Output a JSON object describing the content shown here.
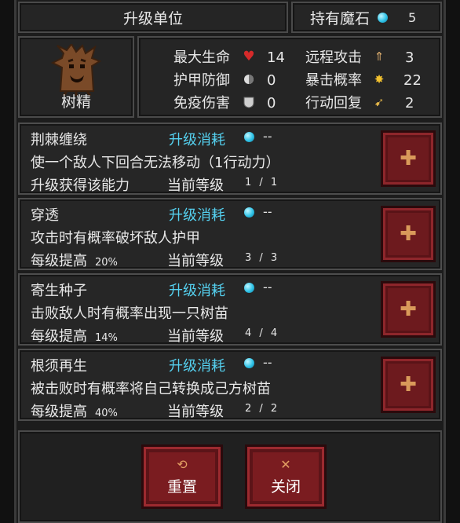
{
  "header": {
    "title": "升级单位",
    "stones_label": "持有魔石",
    "stones_count": "5"
  },
  "unit": {
    "name": "树精"
  },
  "stats": [
    {
      "label": "最大生命",
      "icon": "heart-icon",
      "value": "14"
    },
    {
      "label": "护甲防御",
      "icon": "armor-icon",
      "value": "0"
    },
    {
      "label": "免疫伤害",
      "icon": "shield-icon",
      "value": "0"
    },
    {
      "label": "远程攻击",
      "icon": "arrow-up-icon",
      "value": "3"
    },
    {
      "label": "暴击概率",
      "icon": "burst-icon",
      "value": "22"
    },
    {
      "label": "行动回复",
      "icon": "boot-icon",
      "value": "2"
    }
  ],
  "skills": [
    {
      "name": "荆棘缠绕",
      "cost_label": "升级消耗",
      "cost": "--",
      "desc": "使一个敌人下回合无法移动（1行动力）",
      "note": "升级获得该能力",
      "pct": "",
      "level_label": "当前等级",
      "level": "1 / 1"
    },
    {
      "name": "穿透",
      "cost_label": "升级消耗",
      "cost": "--",
      "desc": "攻击时有概率破坏敌人护甲",
      "note": "每级提高",
      "pct": "20%",
      "level_label": "当前等级",
      "level": "3 / 3"
    },
    {
      "name": "寄生种子",
      "cost_label": "升级消耗",
      "cost": "--",
      "desc": "击败敌人时有概率出现一只树苗",
      "note": "每级提高",
      "pct": "14%",
      "level_label": "当前等级",
      "level": "4 / 4"
    },
    {
      "name": "根须再生",
      "cost_label": "升级消耗",
      "cost": "--",
      "desc": "被击败时有概率将自己转换成己方树苗",
      "note": "每级提高",
      "pct": "40%",
      "level_label": "当前等级",
      "level": "2 / 2"
    }
  ],
  "buttons": {
    "reset": "重置",
    "close": "关闭"
  },
  "colors": {
    "accent_cyan": "#55d1f0",
    "button_red": "#7a1c20",
    "plus_orange": "#d99a5a"
  }
}
